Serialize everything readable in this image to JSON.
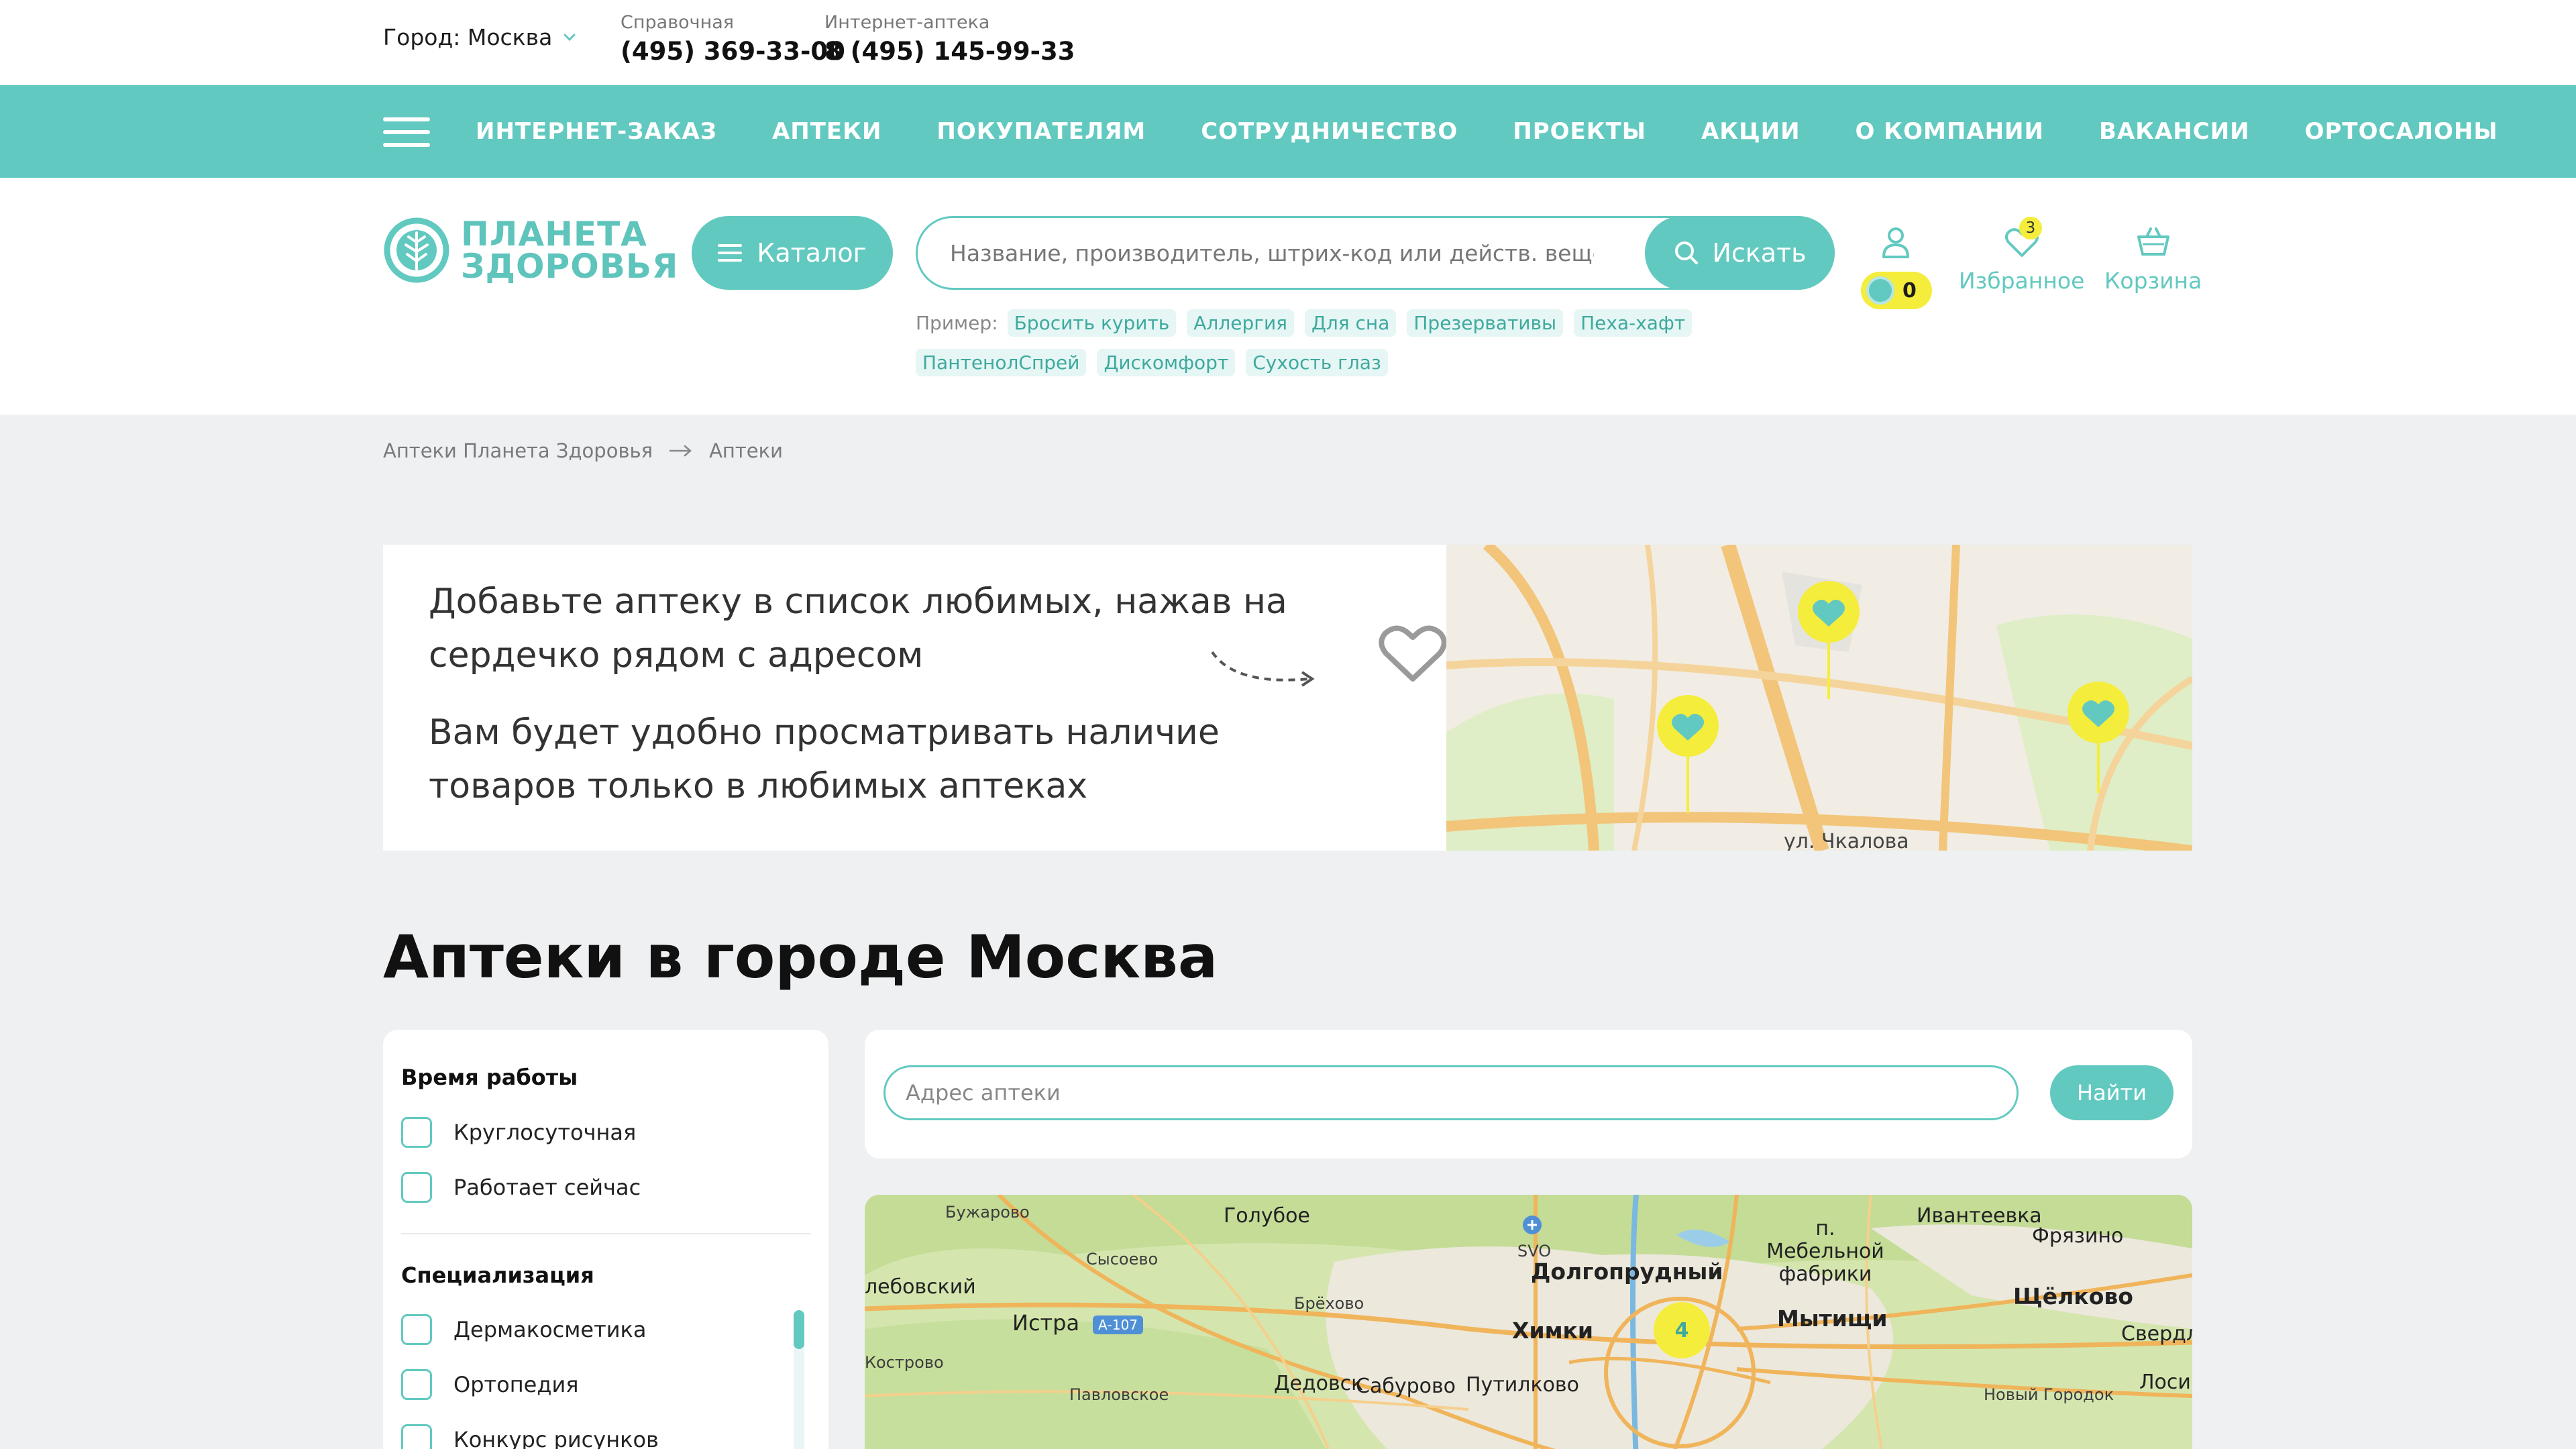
{
  "topbar": {
    "city_label": "Город: Москва",
    "phones": [
      {
        "label": "Справочная",
        "number": "(495) 369-33-00"
      },
      {
        "label": "Интернет-аптека",
        "number": "8 (495) 145-99-33"
      }
    ]
  },
  "nav": {
    "items": [
      "ИНТЕРНЕТ-ЗАКАЗ",
      "АПТЕКИ",
      "ПОКУПАТЕЛЯМ",
      "СОТРУДНИЧЕСТВО",
      "ПРОЕКТЫ",
      "АКЦИИ",
      "О КОМПАНИИ",
      "ВАКАНСИИ",
      "ОРТОСАЛОНЫ"
    ]
  },
  "header": {
    "logo_line1": "ПЛАНЕТА",
    "logo_line2": "ЗДОРОВЬЯ",
    "catalog_label": "Каталог",
    "search_placeholder": "Название, производитель, штрих-код или действ. вещество",
    "search_button": "Искать",
    "examples_label": "Пример:",
    "examples": [
      "Бросить курить",
      "Аллергия",
      "Для сна",
      "Презервативы",
      "Пеха-хафт",
      "ПантенолСпрей",
      "Дискомфорт",
      "Сухость глаз"
    ],
    "bonus_value": "0",
    "favorites_label": "Избранное",
    "favorites_count": "3",
    "cart_label": "Корзина"
  },
  "breadcrumb": {
    "items": [
      "Аптеки Планета Здоровья",
      "Аптеки"
    ]
  },
  "banner": {
    "line1": "Добавьте аптеку в список любимых, нажав на",
    "line2": "сердечко рядом с адресом",
    "line3": "Вам будет удобно просматривать наличие",
    "line4": "товаров только в любимых аптеках",
    "map_street": "ул. Чкалова"
  },
  "page_title": "Аптеки в городе Москва",
  "filters": {
    "groups": [
      {
        "title": "Время работы",
        "options": [
          "Круглосуточная",
          "Работает сейчас"
        ]
      },
      {
        "title": "Специализация",
        "options": [
          "Дермакосметика",
          "Ортопедия",
          "Конкурс рисунков"
        ]
      }
    ]
  },
  "address_search": {
    "placeholder": "Адрес аптеки",
    "button": "Найти"
  },
  "map": {
    "labels": [
      "Бужарово",
      "Голубое",
      "Сысоево",
      "SVO",
      "Долгопрудный",
      "п. Мебельной фабрики",
      "Ивантеевка",
      "Фрязино",
      "лебовский",
      "Истра",
      "А-107",
      "Брёхово",
      "Химки",
      "Мытищи",
      "Щёлково",
      "Свердл",
      "Кострово",
      "Дедовск",
      "Павловское",
      "Сабурово",
      "Путилково",
      "Новый Городок",
      "Лоси"
    ],
    "cluster_count": "4"
  },
  "colors": {
    "accent": "#62c9c0",
    "yellow": "#f5ed3c",
    "background": "#eef0f2"
  }
}
